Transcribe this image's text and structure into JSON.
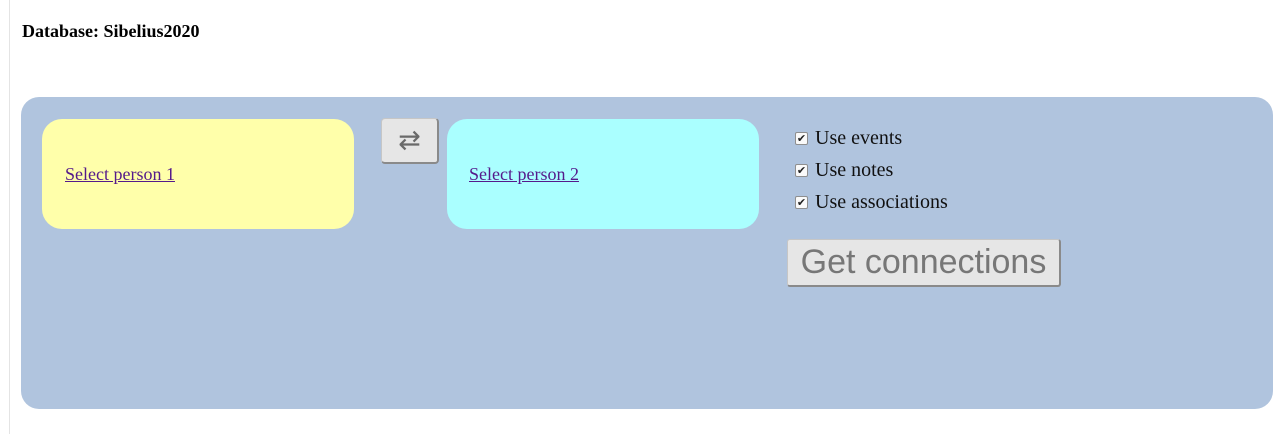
{
  "header": {
    "database_label": "Database: Sibelius2020"
  },
  "person1": {
    "link_label": "Select person 1",
    "bg_color": "#ffffaa"
  },
  "person2": {
    "link_label": "Select person 2",
    "bg_color": "#aaffff"
  },
  "swap_button": {
    "label": "⇄",
    "icon": "swap-arrows-icon"
  },
  "options": [
    {
      "label": "Use events",
      "checked": true
    },
    {
      "label": "Use notes",
      "checked": true
    },
    {
      "label": "Use associations",
      "checked": true
    }
  ],
  "get_connections_button": {
    "label": "Get connections"
  },
  "panel": {
    "bg_color": "#b0c4de"
  }
}
